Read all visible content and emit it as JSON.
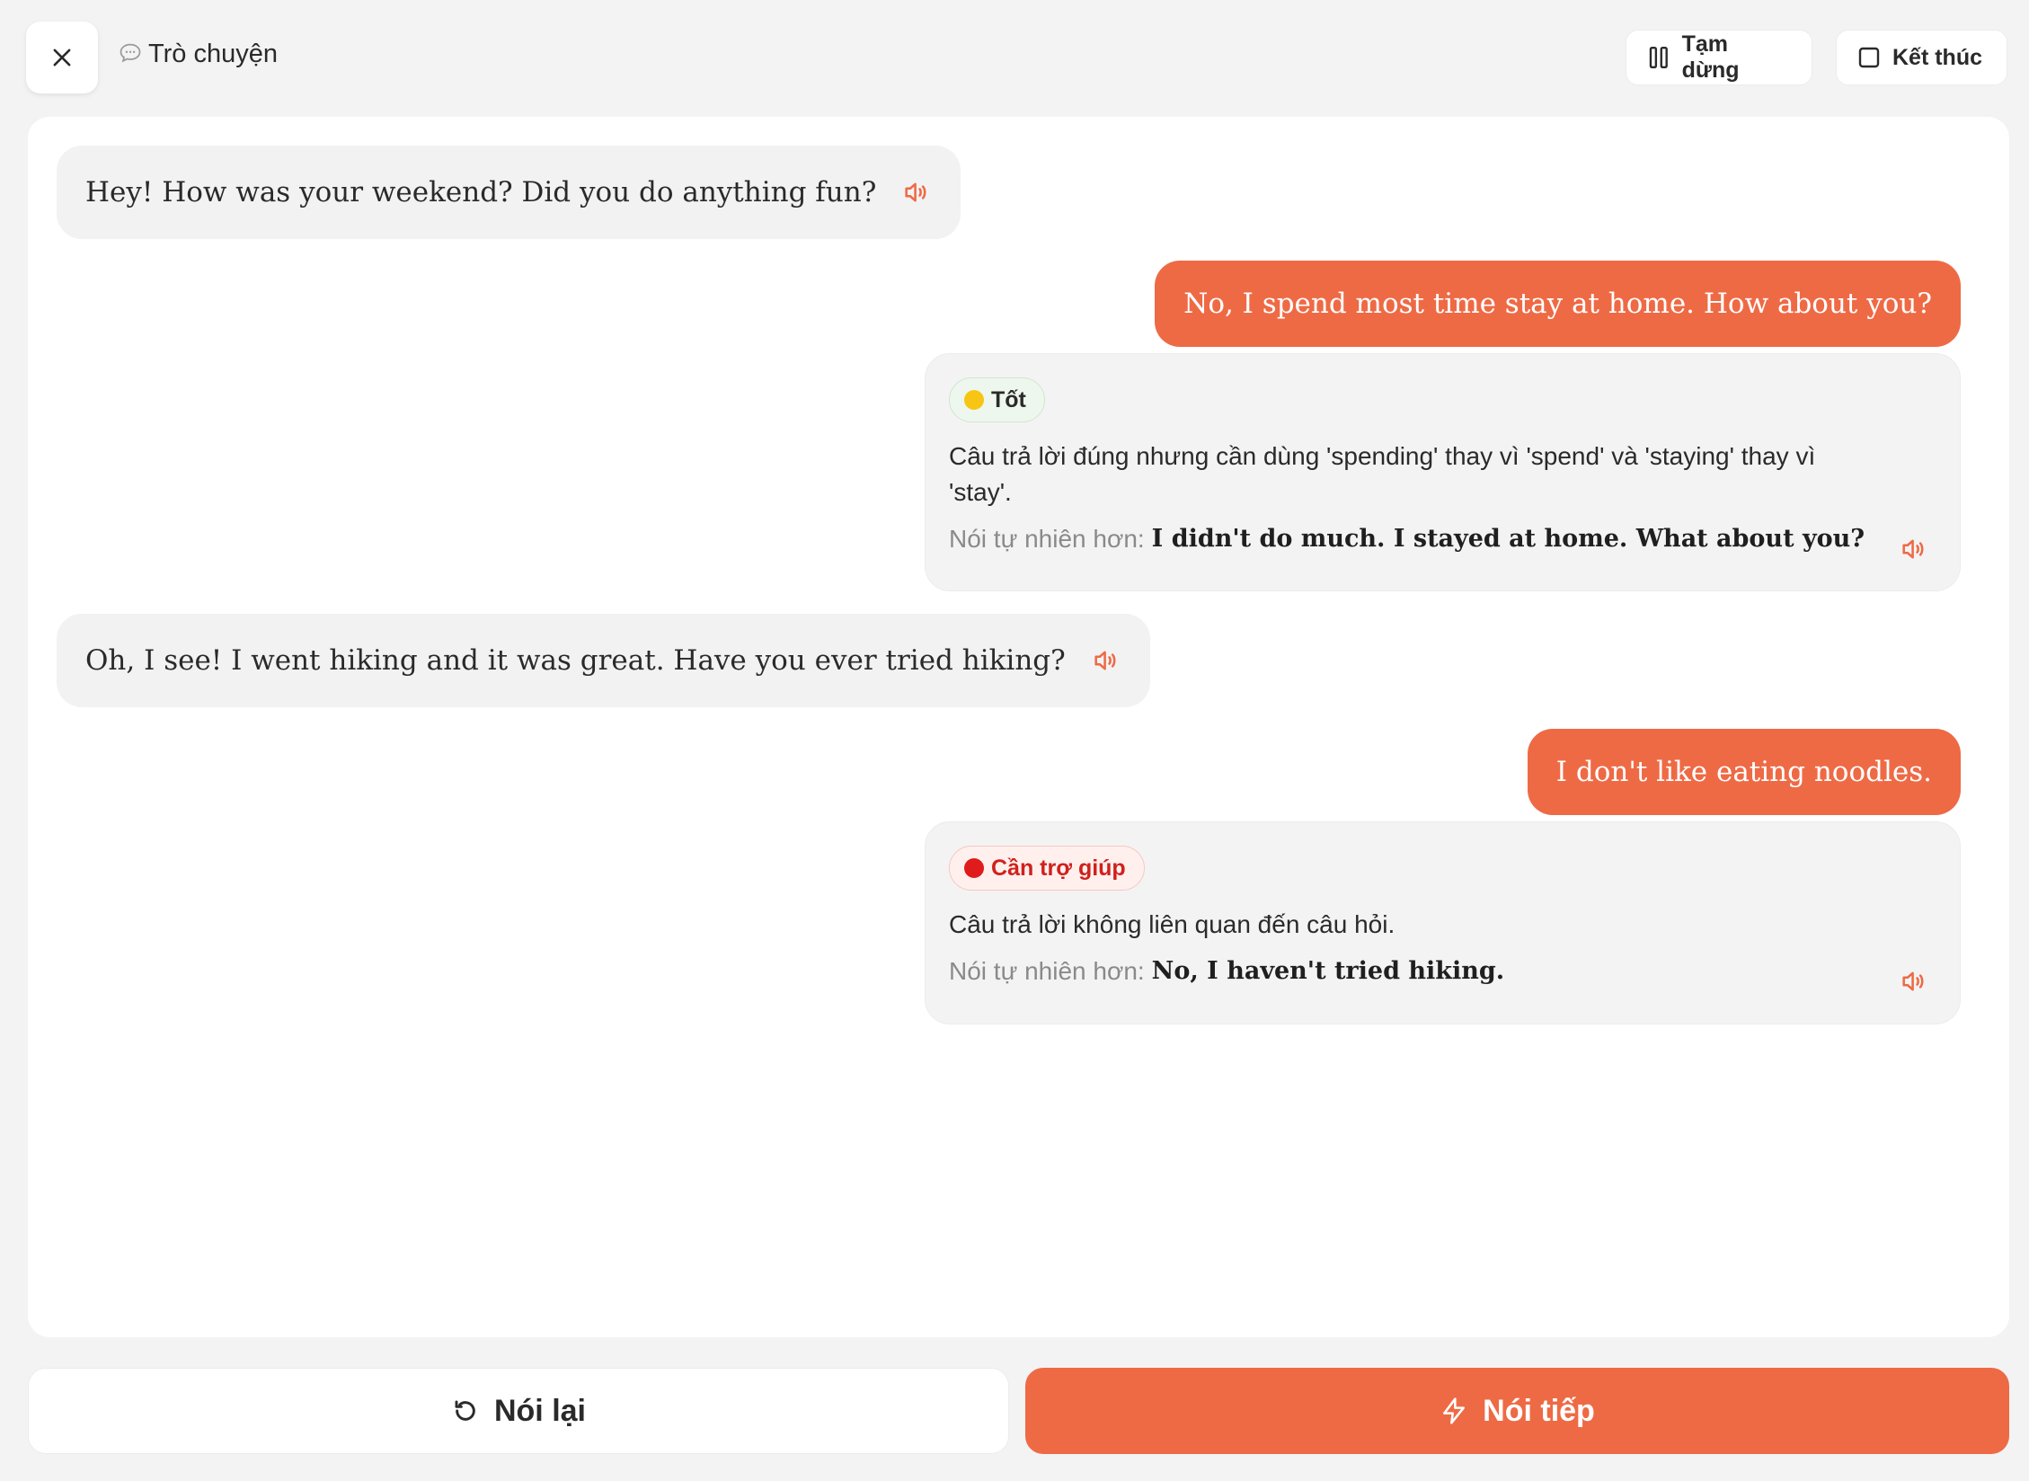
{
  "header": {
    "title": "Trò chuyện",
    "pause_label": "Tạm dừng",
    "end_label": "Kết thúc"
  },
  "messages": [
    {
      "role": "ai",
      "text": "Hey! How was your weekend? Did you do anything fun?"
    },
    {
      "role": "user",
      "text": "No, I spend most time stay at home. How about you?",
      "feedback": {
        "badge": "Tốt",
        "badge_color": "#f7c513",
        "comment_line1": "Câu trả lời đúng nhưng cần dùng 'spending' thay vì 'spend' và 'staying' thay vì",
        "comment_line2": "'stay'.",
        "natural_label": "Nói tự nhiên hơn:",
        "natural_text": "I didn't do much. I stayed at home. What about you?"
      }
    },
    {
      "role": "ai",
      "text": "Oh, I see! I went hiking and it was great. Have you ever tried hiking?"
    },
    {
      "role": "user",
      "text": "I don't like eating noodles.",
      "feedback": {
        "badge": "Cần trợ giúp",
        "badge_color": "#e01b1b",
        "comment": "Câu trả lời không liên quan đến câu hỏi.",
        "natural_label": "Nói tự nhiên hơn:",
        "natural_text": "No, I haven't tried hiking."
      }
    }
  ],
  "footer": {
    "retry_label": "Nói lại",
    "next_label": "Nói tiếp"
  },
  "colors": {
    "accent": "#ee6a45",
    "background": "#f3f3f4",
    "panel": "#ffffff"
  }
}
